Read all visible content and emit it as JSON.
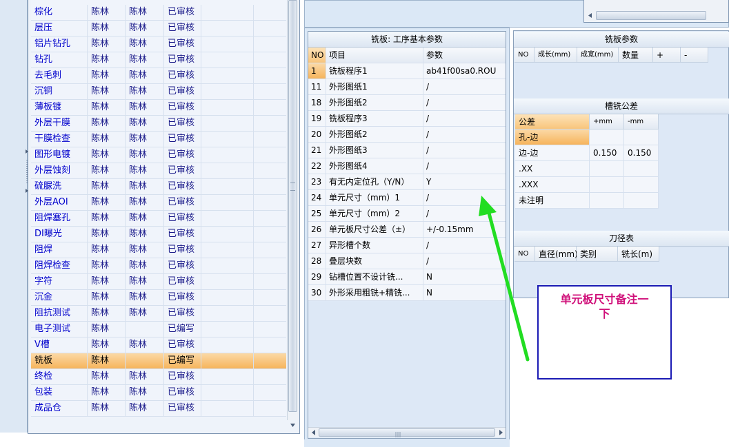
{
  "process_list": {
    "rows": [
      {
        "name": "棕化",
        "c1": "陈林",
        "c2": "陈林",
        "status": "已审核"
      },
      {
        "name": "层压",
        "c1": "陈林",
        "c2": "陈林",
        "status": "已审核"
      },
      {
        "name": "铝片钻孔",
        "c1": "陈林",
        "c2": "陈林",
        "status": "已审核"
      },
      {
        "name": "钻孔",
        "c1": "陈林",
        "c2": "陈林",
        "status": "已审核"
      },
      {
        "name": "去毛刺",
        "c1": "陈林",
        "c2": "陈林",
        "status": "已审核"
      },
      {
        "name": "沉铜",
        "c1": "陈林",
        "c2": "陈林",
        "status": "已审核"
      },
      {
        "name": "薄板镀",
        "c1": "陈林",
        "c2": "陈林",
        "status": "已审核"
      },
      {
        "name": "外层干膜",
        "c1": "陈林",
        "c2": "陈林",
        "status": "已审核"
      },
      {
        "name": "干膜检查",
        "c1": "陈林",
        "c2": "陈林",
        "status": "已审核"
      },
      {
        "name": "图形电镀",
        "c1": "陈林",
        "c2": "陈林",
        "status": "已审核"
      },
      {
        "name": "外层蚀刻",
        "c1": "陈林",
        "c2": "陈林",
        "status": "已审核"
      },
      {
        "name": "硫脲洗",
        "c1": "陈林",
        "c2": "陈林",
        "status": "已审核"
      },
      {
        "name": "外层AOI",
        "c1": "陈林",
        "c2": "陈林",
        "status": "已审核"
      },
      {
        "name": "阻焊塞孔",
        "c1": "陈林",
        "c2": "陈林",
        "status": "已审核"
      },
      {
        "name": "DI曝光",
        "c1": "陈林",
        "c2": "陈林",
        "status": "已审核"
      },
      {
        "name": "阻焊",
        "c1": "陈林",
        "c2": "陈林",
        "status": "已审核"
      },
      {
        "name": "阻焊检查",
        "c1": "陈林",
        "c2": "陈林",
        "status": "已审核"
      },
      {
        "name": "字符",
        "c1": "陈林",
        "c2": "陈林",
        "status": "已审核"
      },
      {
        "name": "沉金",
        "c1": "陈林",
        "c2": "陈林",
        "status": "已审核"
      },
      {
        "name": "阻抗测试",
        "c1": "陈林",
        "c2": "陈林",
        "status": "已审核"
      },
      {
        "name": "电子测试",
        "c1": "陈林",
        "c2": "",
        "status": "已编写"
      },
      {
        "name": "V槽",
        "c1": "陈林",
        "c2": "陈林",
        "status": "已审核"
      },
      {
        "name": "铣板",
        "c1": "陈林",
        "c2": "",
        "status": "已编写"
      },
      {
        "name": "终检",
        "c1": "陈林",
        "c2": "陈林",
        "status": "已审核"
      },
      {
        "name": "包装",
        "c1": "陈林",
        "c2": "陈林",
        "status": "已审核"
      },
      {
        "name": "成品仓",
        "c1": "陈林",
        "c2": "陈林",
        "status": "已审核"
      }
    ],
    "selected_index": 22
  },
  "basic_params": {
    "title": "铣板: 工序基本参数",
    "headers": {
      "no": "NO",
      "item": "项目",
      "param": "参数"
    },
    "rows": [
      {
        "no": "1",
        "item": "铣板程序1",
        "param": "ab41f00sa0.ROU"
      },
      {
        "no": "11",
        "item": "外形图纸1",
        "param": "/"
      },
      {
        "no": "18",
        "item": "外形图纸2",
        "param": "/"
      },
      {
        "no": "19",
        "item": "铣板程序3",
        "param": "/"
      },
      {
        "no": "20",
        "item": "外形图纸2",
        "param": "/"
      },
      {
        "no": "21",
        "item": "外形图纸3",
        "param": "/"
      },
      {
        "no": "22",
        "item": "外形图纸4",
        "param": "/"
      },
      {
        "no": "23",
        "item": "有无内定位孔（Y/N）",
        "param": "Y"
      },
      {
        "no": "24",
        "item": "单元尺寸（mm）1",
        "param": "/"
      },
      {
        "no": "25",
        "item": "单元尺寸（mm）2",
        "param": "/"
      },
      {
        "no": "26",
        "item": "单元板尺寸公差（±）",
        "param": "+/-0.15mm"
      },
      {
        "no": "27",
        "item": "异形槽个数",
        "param": "/"
      },
      {
        "no": "28",
        "item": "叠层块数",
        "param": "/"
      },
      {
        "no": "29",
        "item": "钻槽位置不设计铣...",
        "param": "N"
      },
      {
        "no": "30",
        "item": "外形采用粗铣+精铣...",
        "param": "N"
      }
    ]
  },
  "mill_params": {
    "title": "铣板参数",
    "headers": [
      "NO",
      "成长(mm)",
      "成宽(mm)",
      "数量",
      "+",
      "-"
    ]
  },
  "slot_tolerance": {
    "title": "槽铣公差",
    "headers": [
      "公差",
      "+mm",
      "-mm"
    ],
    "rows": [
      {
        "label": "孔-边",
        "plus": "",
        "minus": ""
      },
      {
        "label": "边-边",
        "plus": "0.150",
        "minus": "0.150"
      },
      {
        "label": ".XX",
        "plus": "",
        "minus": ""
      },
      {
        "label": ".XXX",
        "plus": "",
        "minus": ""
      },
      {
        "label": "未注明",
        "plus": "",
        "minus": ""
      }
    ]
  },
  "tool_table": {
    "title": "刀径表",
    "headers": [
      "NO",
      "直径(mm)",
      "类别",
      "铣长(m)"
    ]
  },
  "annotation": {
    "text_line1": "单元板尺寸备注一",
    "text_line2": "下",
    "arrow_color": "#22dd22",
    "text_color": "#d0107a",
    "border_color": "#1a1ab4"
  }
}
